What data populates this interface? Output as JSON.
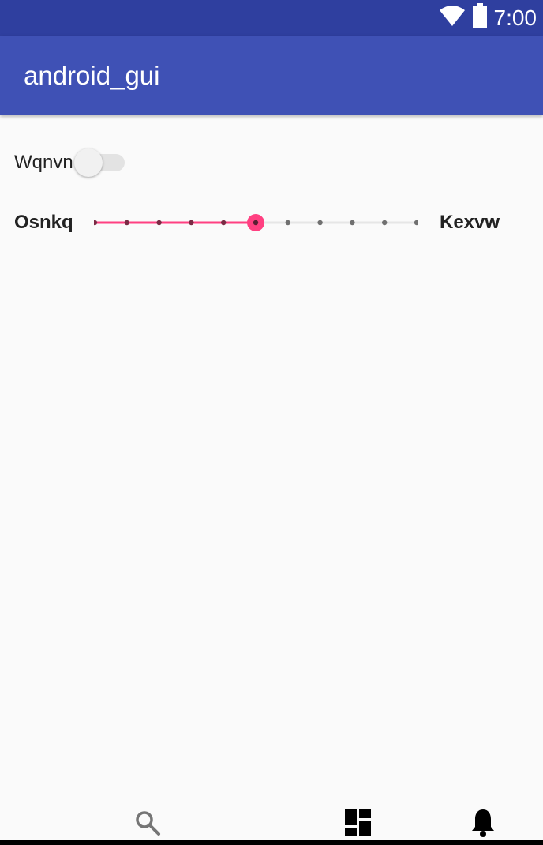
{
  "status_bar": {
    "time": "7:00",
    "icons": [
      "wifi-icon",
      "battery-icon"
    ],
    "background": "#2f3f9f"
  },
  "app_bar": {
    "title": "android_gui",
    "background": "#3f51b5"
  },
  "switch": {
    "label": "Wqnvn",
    "checked": false
  },
  "slider": {
    "left_label": "Osnkq",
    "right_label": "Kexvw",
    "min": 0,
    "max": 10,
    "step": 1,
    "value": 5,
    "accent": "#ff4081"
  },
  "bottom_nav": {
    "items": [
      "search-icon",
      "dashboard-icon",
      "notifications-icon"
    ]
  }
}
